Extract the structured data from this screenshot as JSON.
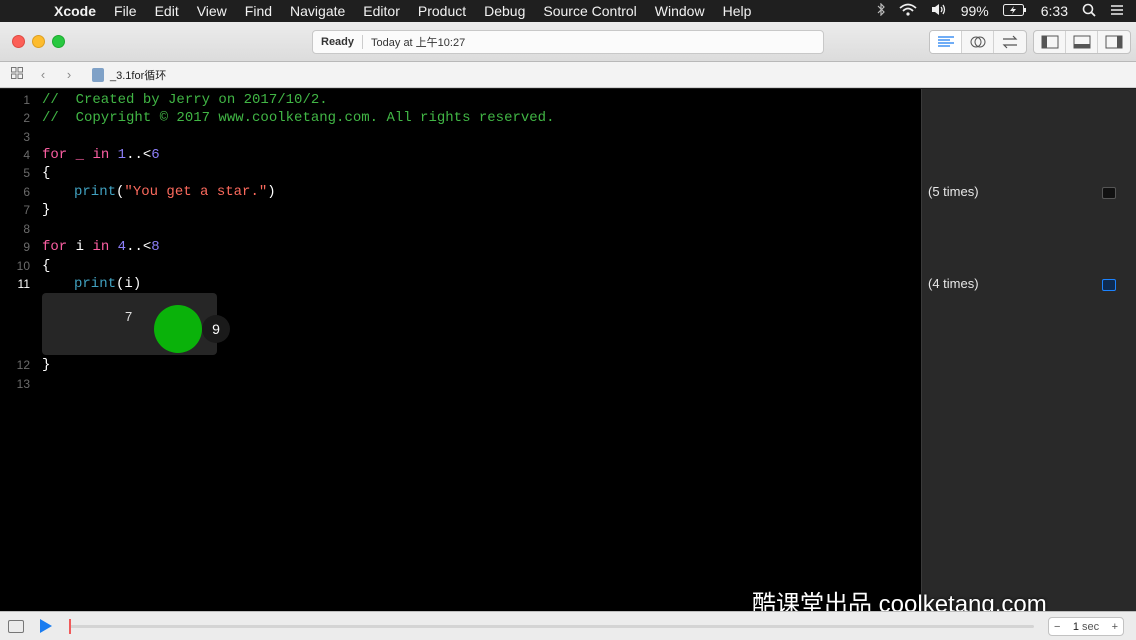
{
  "menubar": {
    "apple": "",
    "app": "Xcode",
    "items": [
      "File",
      "Edit",
      "View",
      "Find",
      "Navigate",
      "Editor",
      "Product",
      "Debug",
      "Source Control",
      "Window",
      "Help"
    ],
    "battery": "99%",
    "time": "6:33",
    "icons": [
      "bluetooth-icon",
      "wifi-icon",
      "volume-icon",
      "battery-icon",
      "search-icon",
      "list-icon"
    ]
  },
  "toolbar": {
    "status_state": "Ready",
    "status_time": "Today at 上午10:27",
    "editor_modes": [
      "standard-editor-icon",
      "assistant-editor-icon",
      "version-editor-icon"
    ],
    "panels": [
      "navigator-icon",
      "debug-area-icon",
      "utilities-icon"
    ]
  },
  "jumpbar": {
    "filename": "_3.1for循环"
  },
  "editor": {
    "line_numbers": [
      "1",
      "2",
      "3",
      "4",
      "5",
      "6",
      "7",
      "8",
      "9",
      "10",
      "11",
      "12",
      "13"
    ],
    "current_line": "11",
    "lines": {
      "l1": "//  Created by Jerry on 2017/10/2.",
      "l2": "//  Copyright © 2017 www.coolketang.com. All rights reserved.",
      "l4_kw1": "for",
      "l4_var": " _ ",
      "l4_kw2": "in",
      "l4_n1": " 1",
      "l4_op": "..<",
      "l4_n2": "6",
      "l5": "{",
      "l6_fn": "print",
      "l6_open": "(",
      "l6_str": "\"You get a star.\"",
      "l6_close": ")",
      "l7": "}",
      "l9_kw1": "for",
      "l9_var": " i ",
      "l9_kw2": "in",
      "l9_n1": " 4",
      "l9_op": "..<",
      "l9_n2": "8",
      "l10": "{",
      "l11_fn": "print",
      "l11_rest": "(i)",
      "l12": "}"
    },
    "inline_result_value": "7",
    "inline_result_badge": "9"
  },
  "results": {
    "r1": "(5 times)",
    "r2": "(4 times)"
  },
  "watermark": "酷课堂出品 coolketang.com",
  "bottombar": {
    "stepper_minus": "−",
    "stepper_value": "1",
    "stepper_unit": "sec",
    "stepper_plus": "+"
  }
}
